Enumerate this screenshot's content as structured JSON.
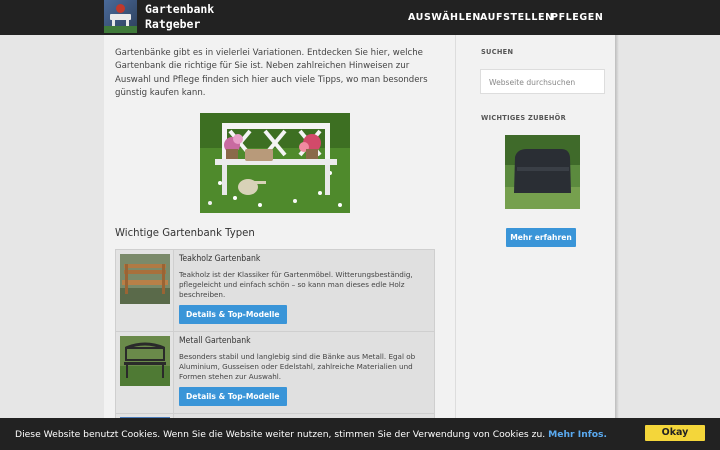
{
  "header": {
    "logo_line1": "Gartenbank",
    "logo_line2": "Ratgeber",
    "nav": [
      "AUSWÄHLEN",
      "AUFSTELLEN",
      "PFLEGEN"
    ]
  },
  "main": {
    "intro": "Gartenbänke gibt es in vielerlei Variationen. Entdecken Sie hier, welche Gartenbank die richtige für Sie ist. Neben zahlreichen Hinweisen zur Auswahl und Pflege finden sich hier auch viele Tipps, wo man besonders günstig kaufen kann.",
    "section_title": "Wichtige Gartenbank Typen",
    "rows": [
      {
        "title": "Teakholz Gartenbank",
        "desc": "Teakholz ist der Klassiker für Gartenmöbel. Witterungsbeständig, pflegeleicht und einfach schön – so kann man dieses edle Holz beschreiben.",
        "button": "Details & Top-Modelle"
      },
      {
        "title": "Metall Gartenbank",
        "desc": "Besonders stabil und langlebig sind die Bänke aus Metall. Egal ob Aluminium, Gusseisen oder Edelstahl, zahlreiche Materialien und Formen stehen zur Auswahl.",
        "button": "Details & Top-Modelle"
      }
    ]
  },
  "sidebar": {
    "search_heading": "SUCHEN",
    "search_placeholder": "Webseite durchsuchen",
    "accessories_heading": "WICHTIGES ZUBEHÖR",
    "more_button": "Mehr erfahren"
  },
  "cookie": {
    "text": "Diese Website benutzt Cookies. Wenn Sie die Website weiter nutzen, stimmen Sie der Verwendung von Cookies zu.",
    "link": "Mehr Infos.",
    "accept": "Okay"
  },
  "colors": {
    "header_bg": "#222222",
    "accent_button": "#3a95d8",
    "cookie_accept": "#f4d63a",
    "cookie_link": "#5aaaf0"
  }
}
